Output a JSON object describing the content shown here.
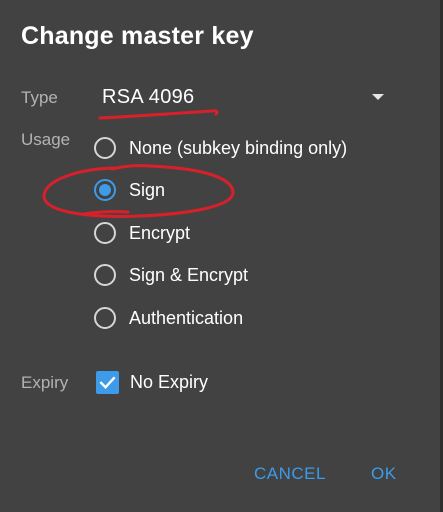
{
  "dialog": {
    "title": "Change master key"
  },
  "type": {
    "label": "Type",
    "selected": "RSA 4096"
  },
  "usage": {
    "label": "Usage",
    "options": [
      {
        "label": "None (subkey binding only)",
        "checked": false
      },
      {
        "label": "Sign",
        "checked": true
      },
      {
        "label": "Encrypt",
        "checked": false
      },
      {
        "label": "Sign & Encrypt",
        "checked": false
      },
      {
        "label": "Authentication",
        "checked": false
      }
    ]
  },
  "expiry": {
    "label": "Expiry",
    "no_expiry_label": "No Expiry",
    "checked": true
  },
  "actions": {
    "cancel_label": "CANCEL",
    "ok_label": "OK"
  },
  "colors": {
    "accent": "#3d9be9",
    "dialog_bg": "#424242",
    "annotation": "#d9202a"
  }
}
